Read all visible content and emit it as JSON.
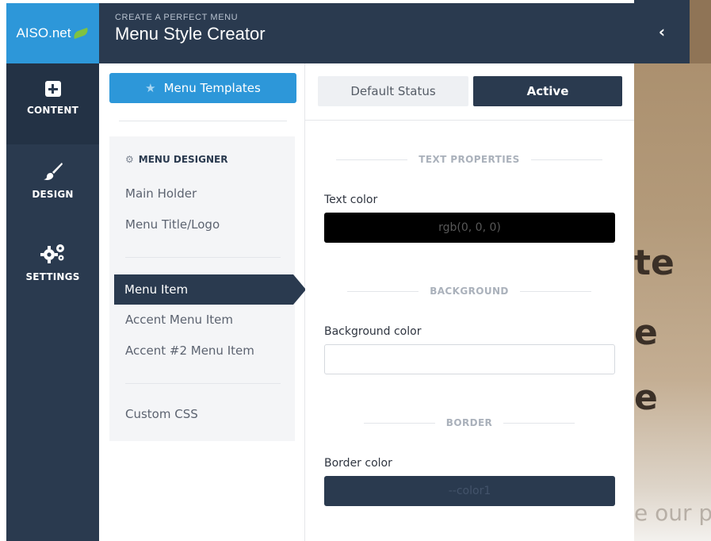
{
  "brand": {
    "logo_text": "AISO.net"
  },
  "header": {
    "subtitle": "CREATE A PERFECT MENU",
    "title": "Menu Style Creator"
  },
  "rail": {
    "items": [
      {
        "label": "CONTENT",
        "icon": "plus-square-icon"
      },
      {
        "label": "DESIGN",
        "icon": "brush-icon"
      },
      {
        "label": "SETTINGS",
        "icon": "gears-icon"
      }
    ]
  },
  "templates_button": {
    "label": "Menu Templates",
    "icon": "star-icon"
  },
  "designer": {
    "heading": "MENU DESIGNER",
    "items": [
      "Main Holder",
      "Menu Title/Logo",
      "Menu Item",
      "Accent Menu Item",
      "Accent #2 Menu Item",
      "Custom CSS"
    ],
    "selected": "Menu Item"
  },
  "tabs": {
    "default_label": "Default Status",
    "active_label": "Active"
  },
  "properties": {
    "text_section": "TEXT PROPERTIES",
    "text_color_label": "Text color",
    "text_color_value": "rgb(0, 0, 0)",
    "background_section": "BACKGROUND",
    "background_color_label": "Background color",
    "background_color_value": "",
    "border_section": "BORDER",
    "border_color_label": "Border color",
    "border_color_value": "--color1"
  },
  "background_page": {
    "fragment_1": "te",
    "fragment_2": "e",
    "fragment_3": "e",
    "fragment_4": "e our p"
  },
  "colors": {
    "navy": "#2a3a4f",
    "blue": "#2d97d9",
    "leaf_green": "#7fc241"
  }
}
